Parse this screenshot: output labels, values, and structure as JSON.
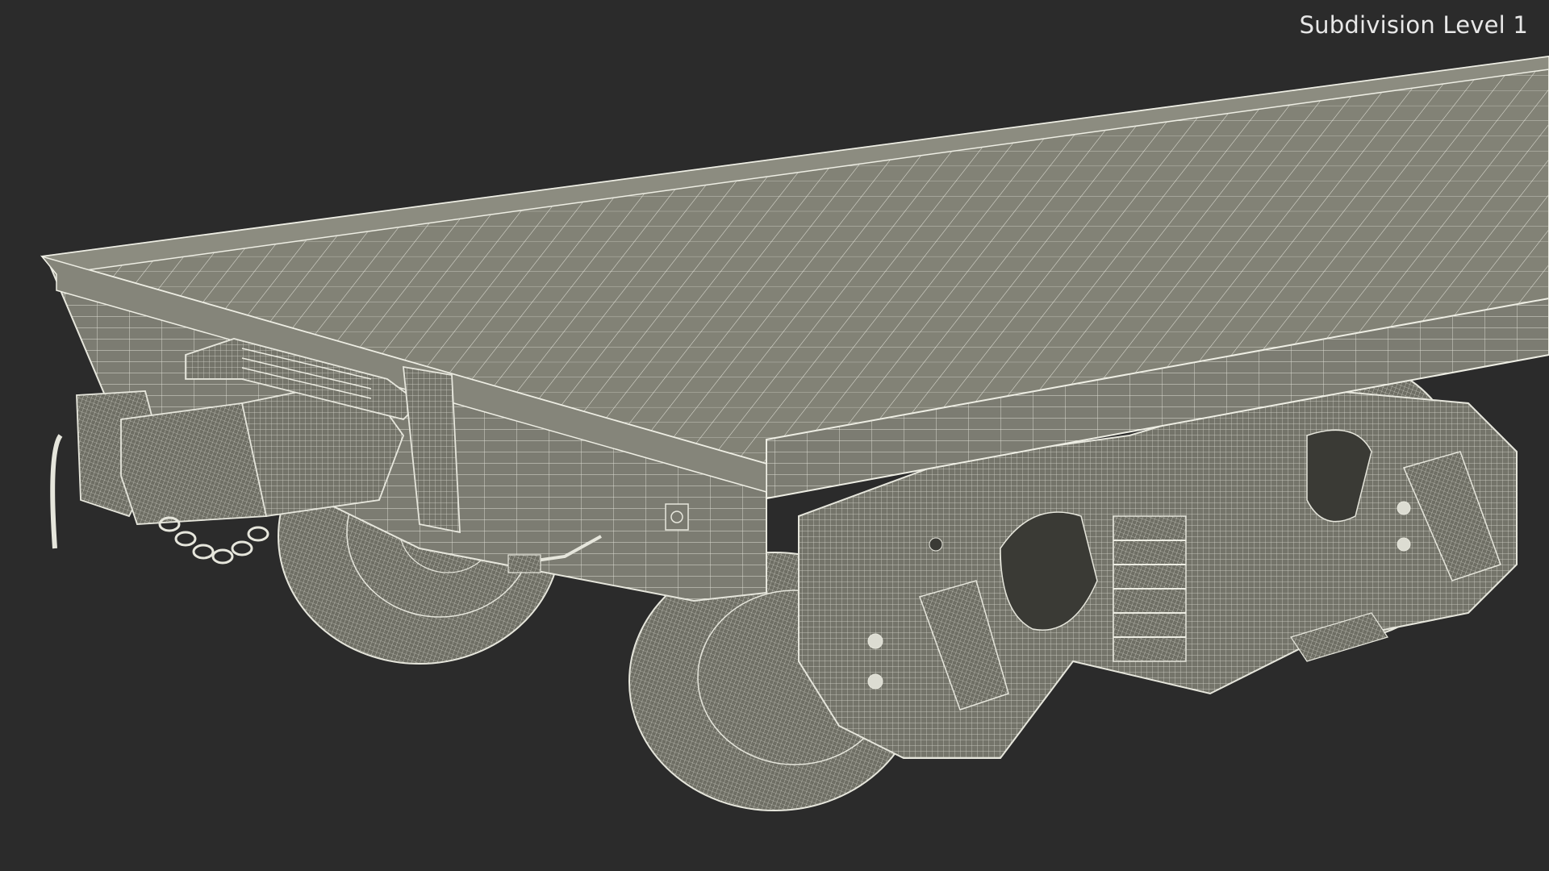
{
  "viewport": {
    "subdivision_label": "Subdivision Level 1",
    "background_color": "#2b2b2b",
    "mesh_fill_color": "#7a7a70",
    "wire_color": "#e6e6dc"
  },
  "scene": {
    "object": "flatcar-wireframe-render"
  }
}
